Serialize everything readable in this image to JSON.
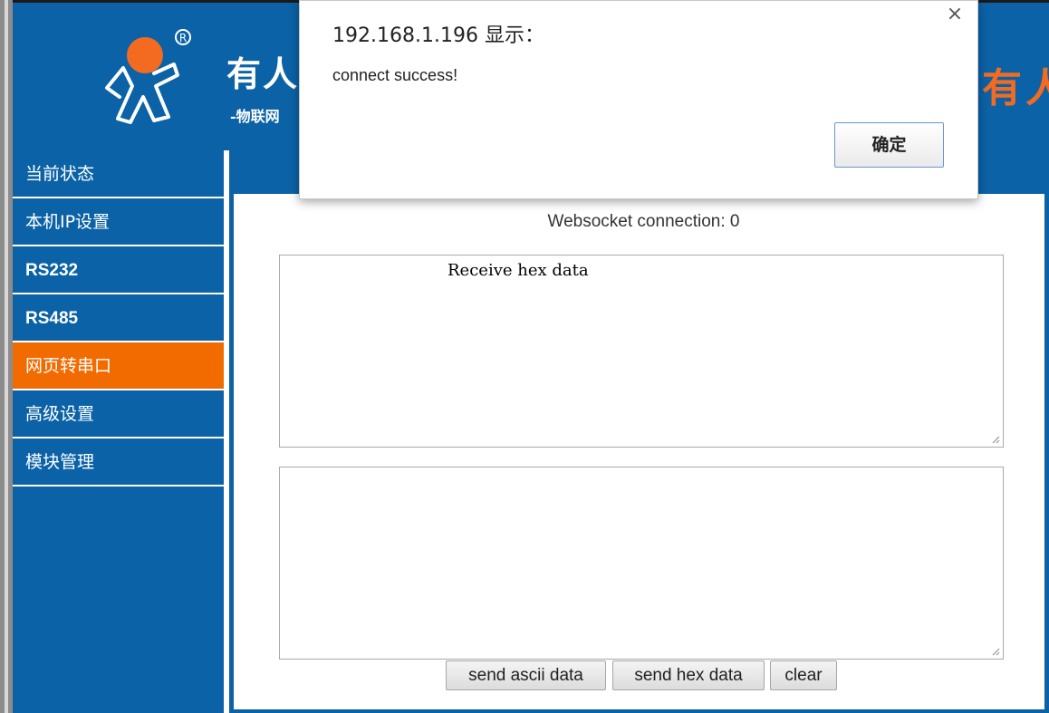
{
  "header": {
    "brand_title": "有人",
    "brand_subtitle": "-物联网",
    "brand_right": "有人"
  },
  "sidebar": {
    "items": [
      {
        "label": "当前状态"
      },
      {
        "label": "本机IP设置"
      },
      {
        "label": "RS232"
      },
      {
        "label": "RS485"
      },
      {
        "label": "网页转串口",
        "active": true
      },
      {
        "label": "高级设置"
      },
      {
        "label": "模块管理"
      }
    ]
  },
  "main": {
    "ws_label": "Websocket connection: 0",
    "receive_value": "Receive hex data",
    "send_value": "",
    "buttons": {
      "send_ascii": "send ascii data",
      "send_hex": "send hex data",
      "clear": "clear"
    }
  },
  "dialog": {
    "title": "192.168.1.196 显示：",
    "message": "connect success!",
    "ok_label": "确定",
    "close_glyph": "×"
  },
  "colors": {
    "brand_blue": "#0b62a6",
    "active_orange": "#f26b00",
    "brand_orange": "#f26b21"
  },
  "icons": {
    "logo": "usr-logo-person-icon",
    "resize": "resize-grip-icon"
  }
}
